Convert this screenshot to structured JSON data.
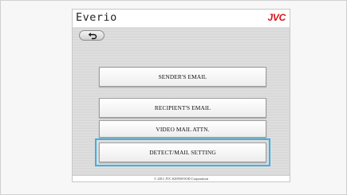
{
  "app": {
    "title": "Everio",
    "brand": "JVC",
    "brand_color": "#d8141a"
  },
  "toolbar": {
    "back_icon": "return-arrow-icon"
  },
  "menu": {
    "items": [
      {
        "label": "SENDER'S EMAIL"
      },
      {
        "label": "RECIPIENT'S EMAIL"
      },
      {
        "label": "VIDEO MAIL ATTN."
      },
      {
        "label": "DETECT/MAIL SETTING",
        "selected": true
      }
    ],
    "selection_color": "#38b3e6"
  },
  "footer": {
    "copyright": "© 2011 JVC KENWOOD Corporation"
  }
}
